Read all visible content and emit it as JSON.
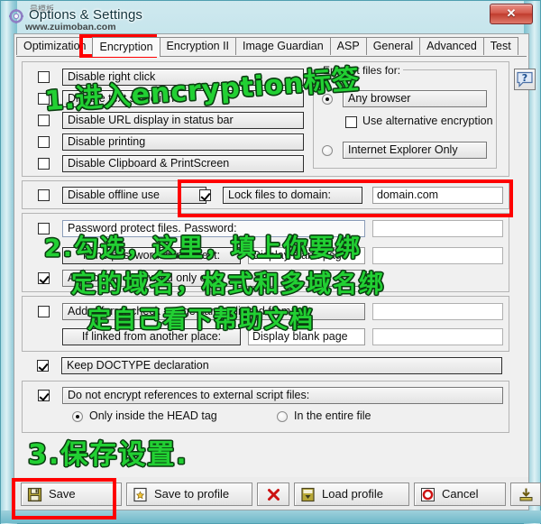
{
  "window": {
    "title": "Options & Settings",
    "close_label": "✕",
    "watermark_cn": "最模板",
    "watermark_url": "www.zuimoban.com",
    "title_icon": "gear-icon"
  },
  "tabs": [
    {
      "label": "Optimization",
      "active": false
    },
    {
      "label": "Encryption",
      "active": true
    },
    {
      "label": "Encryption II",
      "active": false
    },
    {
      "label": "Image Guardian",
      "active": false
    },
    {
      "label": "ASP",
      "active": false
    },
    {
      "label": "General",
      "active": false
    },
    {
      "label": "Advanced",
      "active": false
    },
    {
      "label": "Test",
      "active": false
    }
  ],
  "protection": {
    "items": [
      {
        "label": "Disable right click",
        "checked": false
      },
      {
        "label": "Disable text selection",
        "checked": false
      },
      {
        "label": "Disable URL display in status bar",
        "checked": false
      },
      {
        "label": "Disable printing",
        "checked": false
      },
      {
        "label": "Disable Clipboard & PrintScreen",
        "checked": false
      }
    ]
  },
  "encrypt_group": {
    "title": "Encrypt files for:",
    "any_browser": {
      "label": "Any browser",
      "selected": true
    },
    "alternative": {
      "label": "Use alternative encryption",
      "checked": false
    },
    "ie_only": {
      "label": "Internet Explorer Only",
      "selected": false
    }
  },
  "help_button": {
    "icon": "help-question-icon",
    "label": "?"
  },
  "offline": {
    "disable_offline": {
      "label": "Disable offline use",
      "checked": false
    },
    "lock_domain": {
      "label": "Lock files to domain:",
      "checked": true
    },
    "domain_value": "domain.com",
    "domain_placeholder": ""
  },
  "password": {
    "protect": {
      "label": "Password protect files. Password:",
      "checked": false
    },
    "protect_value": "",
    "incorrect_label": "If the password is incorrect:",
    "incorrect_action": "Display blank page",
    "incorrect_value": "",
    "ask_once": {
      "label": "Ask for the password only once",
      "checked": true
    }
  },
  "referrer": {
    "add_check": {
      "label": "Add referrer check - page can be linked from:",
      "checked": false
    },
    "allowed_value": "",
    "linked_label": "If linked from another place:",
    "linked_action": "Display blank page",
    "linked_value": ""
  },
  "doctype": {
    "label": "Keep DOCTYPE declaration",
    "checked": true
  },
  "external_scripts": {
    "label": "Do not encrypt references to external script files:",
    "checked": true,
    "head_only": {
      "label": "Only inside the HEAD tag",
      "selected": true
    },
    "entire_file": {
      "label": "In the entire file",
      "selected": false
    }
  },
  "bottom_buttons": [
    {
      "label": "Save",
      "icon": "floppy-disk-icon"
    },
    {
      "label": "Save to profile",
      "icon": "save-profile-icon"
    },
    {
      "label": "",
      "icon": "red-x-icon"
    },
    {
      "label": "Load profile",
      "icon": "load-profile-icon"
    },
    {
      "label": "Cancel",
      "icon": "cancel-circle-icon"
    },
    {
      "label": "",
      "icon": "download-arrow-icon"
    }
  ],
  "annotations": [
    {
      "id": "step1",
      "text": "1.进入encryption标签"
    },
    {
      "id": "step2a",
      "text": "2.勾选，这里，填上你要绑"
    },
    {
      "id": "step2b",
      "text": "定的域名，格式和多域名绑"
    },
    {
      "id": "step2c",
      "text": "定自己看下帮助文档"
    },
    {
      "id": "step3",
      "text": "3.保存设置."
    }
  ],
  "colors": {
    "highlight": "#ff0000",
    "annotation": "#22d033",
    "window_glass": "#8ec9d6",
    "client_bg": "#f0f0f0"
  }
}
